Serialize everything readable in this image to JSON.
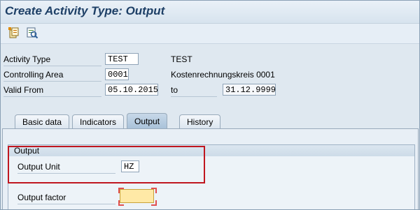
{
  "window": {
    "title": "Create Activity Type: Output"
  },
  "toolbar": {
    "icons": [
      "copy-template-icon",
      "display-details-icon"
    ]
  },
  "header": {
    "activity_type": {
      "label": "Activity Type",
      "value": "TEST",
      "description": "TEST"
    },
    "controlling_area": {
      "label": "Controlling Area",
      "value": "0001",
      "description": "Kostenrechnungskreis 0001"
    },
    "valid_from": {
      "label": "Valid From",
      "value": "05.10.2015",
      "to_label": "to",
      "to_value": "31.12.9999"
    }
  },
  "tabs": [
    {
      "label": "Basic data",
      "active": false
    },
    {
      "label": "Indicators",
      "active": false
    },
    {
      "label": "Output",
      "active": true
    },
    {
      "label": "History",
      "active": false
    }
  ],
  "output_group": {
    "title": "Output",
    "output_unit": {
      "label": "Output Unit",
      "value": "HZ"
    },
    "output_factor": {
      "label": "Output factor",
      "value": ""
    }
  },
  "colors": {
    "highlight": "#c0161f",
    "title": "#1d3f66",
    "required_field": "#ffe9a6"
  }
}
